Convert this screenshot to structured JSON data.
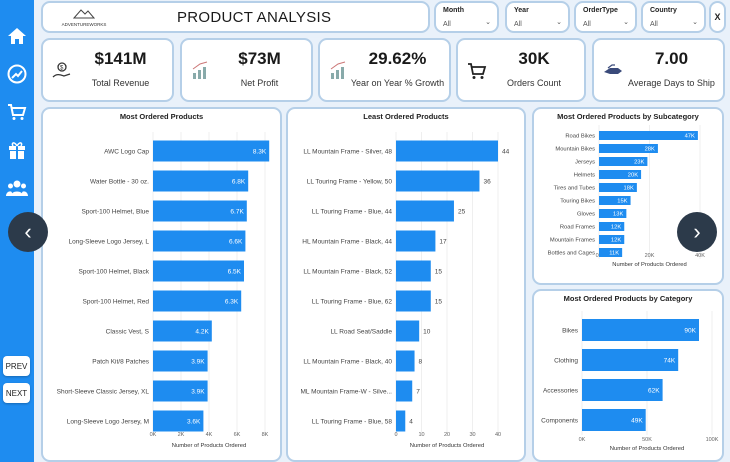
{
  "header": {
    "logo_text": "ADVENTUREWORKS",
    "title": "PRODUCT ANALYSIS",
    "close_label": "X"
  },
  "filters": [
    {
      "label": "Month",
      "value": "All"
    },
    {
      "label": "Year",
      "value": "All"
    },
    {
      "label": "OrderType",
      "value": "All"
    },
    {
      "label": "Country",
      "value": "All"
    }
  ],
  "kpis": [
    {
      "value": "$141M",
      "label": "Total Revenue",
      "icon": "money-hand-icon"
    },
    {
      "value": "$73M",
      "label": "Net Profit",
      "icon": "growth-chart-icon"
    },
    {
      "value": "29.62%",
      "label": "Year on Year % Growth",
      "icon": "growth-chart-icon"
    },
    {
      "value": "30K",
      "label": "Orders Count",
      "icon": "cart-icon"
    },
    {
      "value": "7.00",
      "label": "Average Days to Ship",
      "icon": "shipping-icon"
    }
  ],
  "sidebar": {
    "items": [
      {
        "name": "home-icon"
      },
      {
        "name": "dollar-chart-icon"
      },
      {
        "name": "cart-icon"
      },
      {
        "name": "gift-icon"
      },
      {
        "name": "customers-icon"
      }
    ],
    "prev_label": "PREV",
    "next_label": "NEXT"
  },
  "carousel": {
    "prev_label": "‹",
    "next_label": "›"
  },
  "chart_data": [
    {
      "type": "bar",
      "orientation": "horizontal",
      "title": "Most Ordered Products",
      "xlabel": "Number of Products Ordered",
      "xlim": [
        0,
        8000
      ],
      "ticks": [
        "0K",
        "2K",
        "4K",
        "6K",
        "8K"
      ],
      "categories": [
        "AWC Logo Cap",
        "Water Bottle - 30 oz.",
        "Sport-100 Helmet, Blue",
        "Long-Sleeve Logo Jersey, L",
        "Sport-100 Helmet, Black",
        "Sport-100 Helmet, Red",
        "Classic Vest, S",
        "Patch Kit/8 Patches",
        "Short-Sleeve Classic Jersey, XL",
        "Long-Sleeve Logo Jersey, M"
      ],
      "values": [
        8300,
        6800,
        6700,
        6600,
        6500,
        6300,
        4200,
        3900,
        3900,
        3600
      ],
      "value_labels": [
        "8.3K",
        "6.8K",
        "6.7K",
        "6.6K",
        "6.5K",
        "6.3K",
        "4.2K",
        "3.9K",
        "3.9K",
        "3.6K"
      ],
      "color": "#1e8cf0"
    },
    {
      "type": "bar",
      "orientation": "horizontal",
      "title": "Least Ordered Products",
      "xlabel": "Number of Products Ordered",
      "xlim": [
        0,
        44
      ],
      "ticks": [
        "0",
        "10",
        "20",
        "30",
        "40"
      ],
      "categories": [
        "LL Mountain Frame - Silver, 48",
        "LL Touring Frame - Yellow, 50",
        "LL Touring Frame - Blue, 44",
        "HL Mountain Frame - Black, 44",
        "LL Mountain Frame - Black, 52",
        "LL Touring Frame - Blue, 62",
        "LL Road Seat/Saddle",
        "LL Mountain Frame - Black, 40",
        "ML Mountain Frame-W - Silve...",
        "LL Touring Frame - Blue, 58"
      ],
      "values": [
        44,
        36,
        25,
        17,
        15,
        15,
        10,
        8,
        7,
        4
      ],
      "value_labels": [
        "44",
        "36",
        "25",
        "17",
        "15",
        "15",
        "10",
        "8",
        "7",
        "4"
      ],
      "color": "#1e8cf0"
    },
    {
      "type": "bar",
      "orientation": "horizontal",
      "title": "Most Ordered Products by Subcategory",
      "xlabel": "Number of Products Ordered",
      "xlim": [
        0,
        48000
      ],
      "ticks": [
        "0K",
        "20K",
        "40K"
      ],
      "categories": [
        "Road Bikes",
        "Mountain Bikes",
        "Jerseys",
        "Helmets",
        "Tires and Tubes",
        "Touring Bikes",
        "Gloves",
        "Road Frames",
        "Mountain Frames",
        "Bottles and Cages"
      ],
      "values": [
        47000,
        28000,
        23000,
        20000,
        18000,
        15000,
        13000,
        12000,
        12000,
        11000
      ],
      "value_labels": [
        "47K",
        "28K",
        "23K",
        "20K",
        "18K",
        "15K",
        "13K",
        "12K",
        "12K",
        "11K"
      ],
      "color": "#1e8cf0"
    },
    {
      "type": "bar",
      "orientation": "horizontal",
      "title": "Most Ordered Products by Category",
      "xlabel": "Number of Products Ordered",
      "xlim": [
        0,
        100000
      ],
      "ticks": [
        "0K",
        "50K",
        "100K"
      ],
      "categories": [
        "Bikes",
        "Clothing",
        "Accessories",
        "Components"
      ],
      "values": [
        90000,
        74000,
        62000,
        49000
      ],
      "value_labels": [
        "90K",
        "74K",
        "62K",
        "49K"
      ],
      "color": "#1e8cf0"
    }
  ]
}
